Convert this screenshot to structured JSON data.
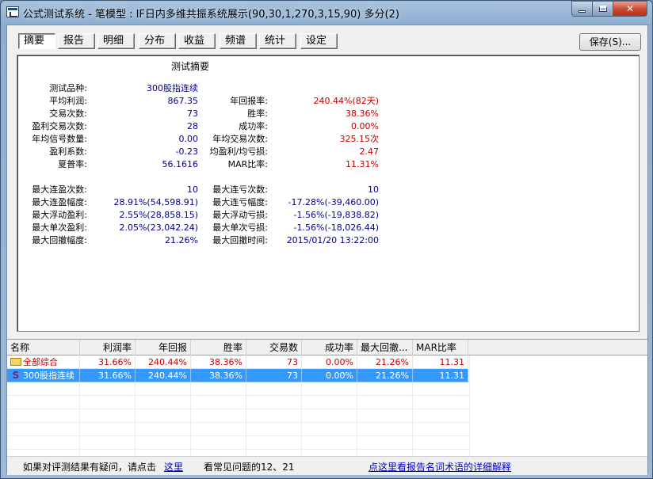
{
  "window": {
    "title": "公式测试系统 - 笔模型 : IF日内多维共振系统展示(90,30,1,270,3,15,90) 多分(2)",
    "minimize_icon": "minimize-icon",
    "maximize_icon": "maximize-icon",
    "close_label": "✕"
  },
  "tabs": [
    "摘要",
    "报告",
    "明细",
    "分布",
    "收益",
    "频谱",
    "统计",
    "设定"
  ],
  "active_tab": "摘要",
  "save_button": "保存(S)...",
  "summary": {
    "title": "测试摘要",
    "left": [
      {
        "label": "测试品种:",
        "value": "300股指连续"
      },
      {
        "label": "平均利润:",
        "value": "867.35"
      },
      {
        "label": "交易次数:",
        "value": "73"
      },
      {
        "label": "盈利交易次数:",
        "value": "28"
      },
      {
        "label": "年均信号数量:",
        "value": "0.00"
      },
      {
        "label": "盈利系数:",
        "value": "-0.23"
      },
      {
        "label": "夏普率:",
        "value": "56.1616"
      }
    ],
    "right": [
      {
        "label": "年回报率:",
        "value": "240.44%(82天)"
      },
      {
        "label": "胜率:",
        "value": "38.36%"
      },
      {
        "label": "成功率:",
        "value": "0.00%"
      },
      {
        "label": "年均交易次数:",
        "value": "325.15次"
      },
      {
        "label": "均盈利/均亏损:",
        "value": "2.47"
      },
      {
        "label": "MAR比率:",
        "value": "11.31%"
      }
    ],
    "left2": [
      {
        "label": "最大连盈次数:",
        "value": "10"
      },
      {
        "label": "最大连盈幅度:",
        "value": "28.91%(54,598.91)"
      },
      {
        "label": "最大浮动盈利:",
        "value": "2.55%(28,858.15)"
      },
      {
        "label": "最大单次盈利:",
        "value": "2.05%(23,042.24)"
      },
      {
        "label": "最大回撤幅度:",
        "value": "21.26%"
      }
    ],
    "right2": [
      {
        "label": "最大连亏次数:",
        "value": "10"
      },
      {
        "label": "最大连亏幅度:",
        "value": "-17.28%(-39,460.00)"
      },
      {
        "label": "最大浮动亏损:",
        "value": "-1.56%(-19,838.82)"
      },
      {
        "label": "最大单次亏损:",
        "value": "-1.56%(-18,026.44)"
      },
      {
        "label": "最大回撤时间:",
        "value": "2015/01/20 13:22:00"
      }
    ]
  },
  "grid": {
    "columns": [
      "名称",
      "利润率",
      "年回报",
      "胜率",
      "交易数",
      "成功率",
      "最大回撤...",
      "MAR比率"
    ],
    "rows": [
      {
        "icon": "folder-icon",
        "name": "全部综合",
        "cells": [
          "31.66%",
          "240.44%",
          "38.36%",
          "73",
          "0.00%",
          "21.26%",
          "11.31"
        ],
        "selected": false
      },
      {
        "icon": "s-icon",
        "icon_glyph": "S",
        "name": "300股指连续",
        "cells": [
          "31.66%",
          "240.44%",
          "38.36%",
          "73",
          "0.00%",
          "21.26%",
          "11.31"
        ],
        "selected": true
      }
    ]
  },
  "status": {
    "question_text": "如果对评测结果有疑问，请点击",
    "here_link": "这里",
    "faq_text": "看常见问题的12、21",
    "glossary_link": "点这里看报告名词术语的详细解释"
  },
  "colors": {
    "value_blue": "#00008b",
    "value_red": "#c00000",
    "selection": "#3399ff"
  }
}
